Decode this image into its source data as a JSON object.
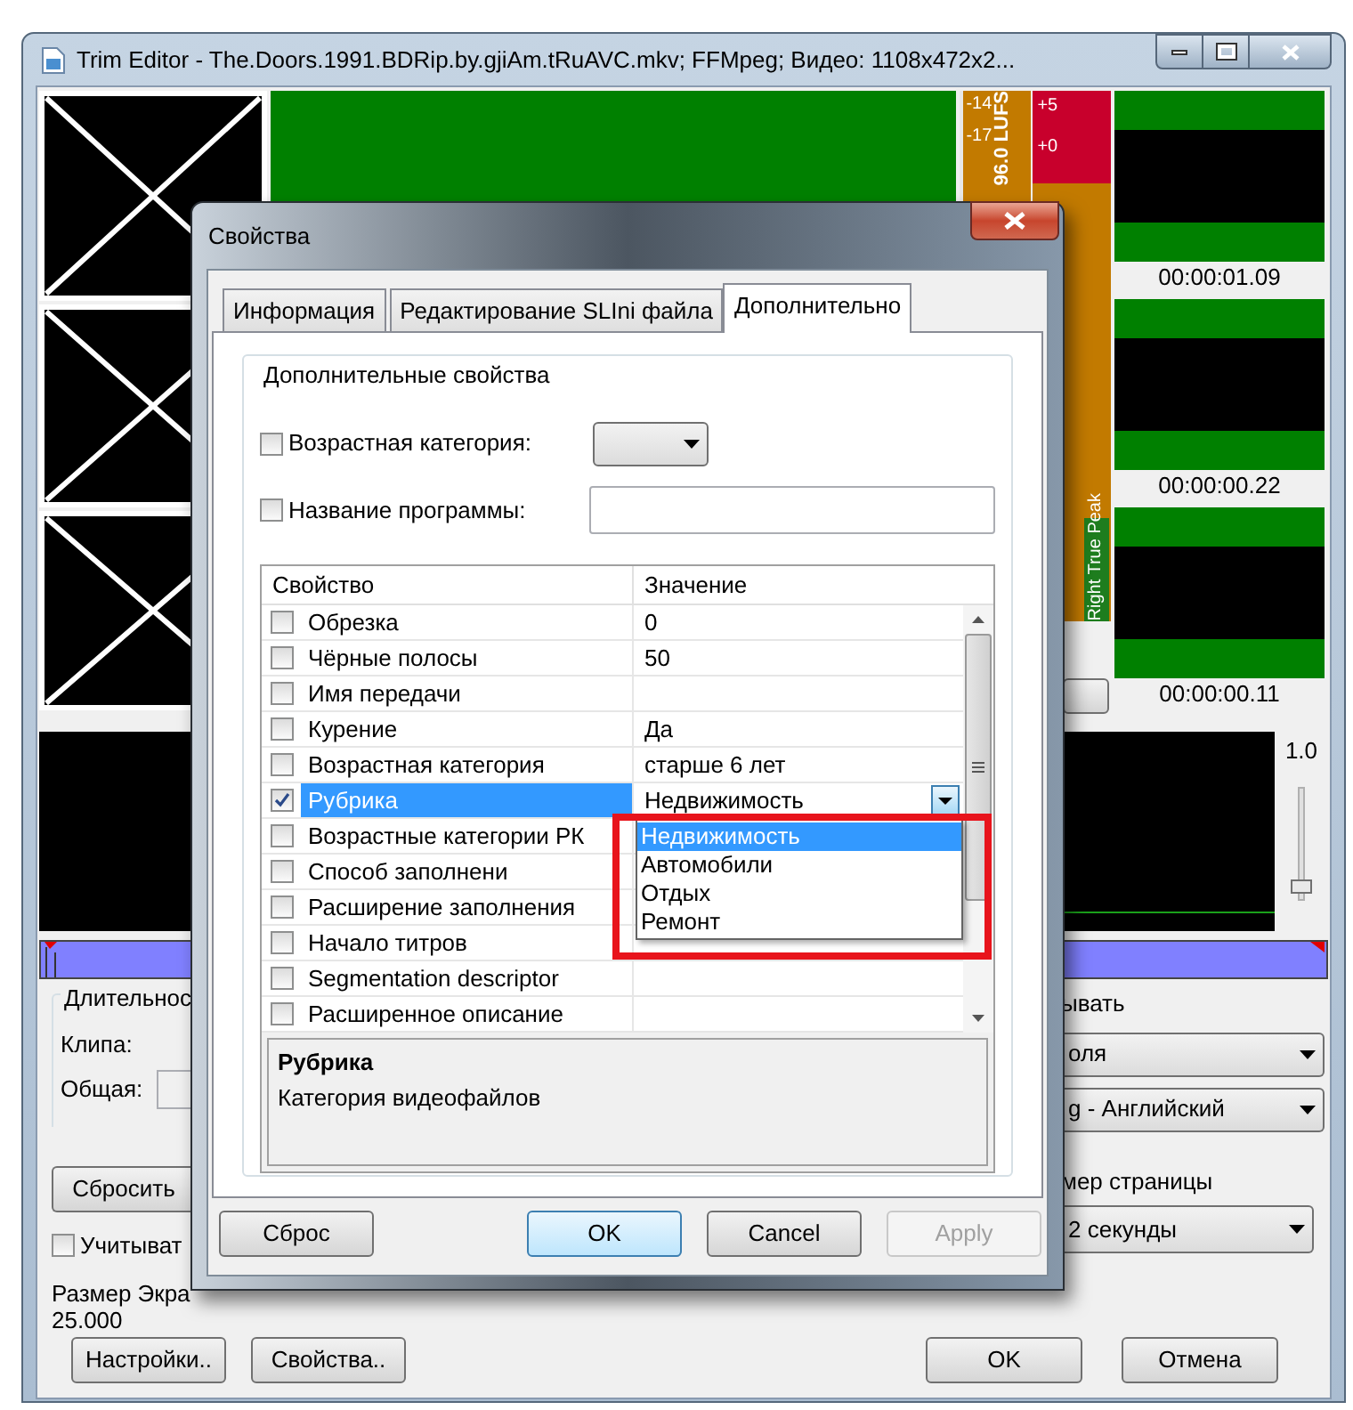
{
  "window": {
    "title": "Trim Editor - The.Doors.1991.BDRip.by.gjiAm.tRuAVC.mkv; FFMpeg; Видео: 1108x472x2..."
  },
  "meter": {
    "lufs_ticks": [
      "-14",
      "-17"
    ],
    "lufs_reading": "96.0 LUFS",
    "peak_ticks": [
      "+5",
      "+0"
    ],
    "peak_label": "Right True Peak"
  },
  "clips": [
    {
      "time": "00:00:01.09"
    },
    {
      "time": "00:00:00.22"
    },
    {
      "time": "00:00:00.11"
    }
  ],
  "gain": {
    "label": "1.0",
    "level": 0.12
  },
  "duration_group": {
    "title": "Длительнос",
    "clip_label": "Клипа:",
    "total_label": "Общая:"
  },
  "reset_button": "Сбросить",
  "account_checkbox": {
    "label": "Учитыват",
    "checked": false
  },
  "screen_size": {
    "label": "Размер Экра",
    "value": "25.000"
  },
  "right_panel": {
    "group_title": "ывать",
    "combos": [
      "оля",
      "g - Английский"
    ],
    "page_size_label": "мер страницы",
    "page_size_value": "2 секунды"
  },
  "bottom_buttons_left": [
    "Настройки..",
    "Свойства.."
  ],
  "bottom_buttons_right": [
    "OK",
    "Отмена"
  ],
  "dialog": {
    "title": "Свойства",
    "tabs": [
      {
        "label": "Информация",
        "selected": false
      },
      {
        "label": "Редактирование SLIni файла",
        "selected": false
      },
      {
        "label": "Дополнительно",
        "selected": true
      }
    ],
    "group_title": "Дополнительные свойства",
    "age_category": {
      "label": "Возрастная категория:",
      "checked": false
    },
    "program_name": {
      "label": "Название программы:",
      "checked": false
    },
    "grid": {
      "columns": [
        "Свойство",
        "Значение"
      ],
      "rows": [
        {
          "name": "Обрезка",
          "value": "0",
          "checked": false,
          "selected": false
        },
        {
          "name": "Чёрные полосы",
          "value": "50",
          "checked": false,
          "selected": false
        },
        {
          "name": "Имя передачи",
          "checked": false,
          "selected": false
        },
        {
          "name": "Курение",
          "value": "Да",
          "checked": false,
          "selected": false
        },
        {
          "name": "Возрастная категория",
          "value": "старше 6 лет",
          "checked": false,
          "selected": false
        },
        {
          "name": "Рубрика",
          "value": "Недвижимость",
          "checked": true,
          "selected": true
        },
        {
          "name": "Возрастные категории РК",
          "checked": false,
          "selected": false
        },
        {
          "name": "Способ заполнени",
          "checked": false,
          "selected": false
        },
        {
          "name": "Расширение заполнения",
          "checked": false,
          "selected": false
        },
        {
          "name": "Начало титров",
          "checked": false,
          "selected": false
        },
        {
          "name": "Segmentation descriptor",
          "checked": false,
          "selected": false
        },
        {
          "name": "Расширенное описание",
          "checked": false,
          "selected": false
        }
      ]
    },
    "dropdown": {
      "options": [
        {
          "label": "Недвижимость",
          "selected": true
        },
        {
          "label": "Автомобили",
          "selected": false
        },
        {
          "label": "Отдых",
          "selected": false
        },
        {
          "label": "Ремонт",
          "selected": false
        }
      ]
    },
    "description": {
      "title": "Рубрика",
      "text": "Категория видеофайлов"
    },
    "buttons": [
      {
        "label": "Сброс",
        "default": false,
        "disabled": false
      },
      {
        "label": "OK",
        "default": true,
        "disabled": false
      },
      {
        "label": "Cancel",
        "default": false,
        "disabled": false
      },
      {
        "label": "Apply",
        "default": false,
        "disabled": true
      }
    ]
  }
}
